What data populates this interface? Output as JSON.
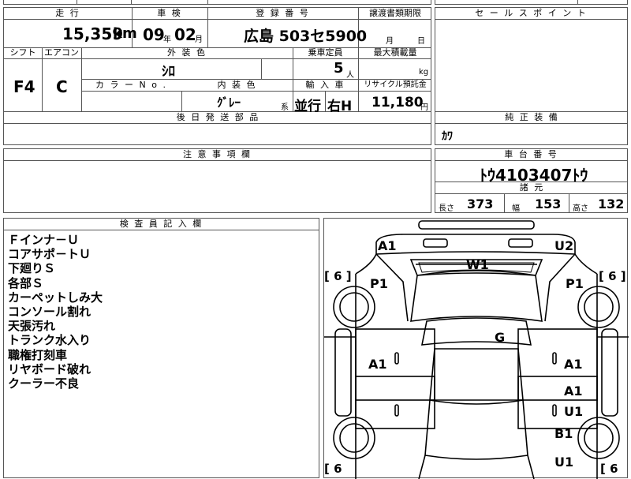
{
  "top_fragment": "",
  "mileage": {
    "header": "走 行",
    "value": "15,359",
    "unit": "km"
  },
  "inspection": {
    "header": "車 検",
    "year": "09",
    "year_unit": "年",
    "month": "02",
    "month_unit": "月"
  },
  "registration": {
    "header": "登 録 番 号",
    "value": "広島 503セ5900"
  },
  "transfer_docs": {
    "header": "譲渡書類期限",
    "month_unit": "月",
    "day_unit": "日"
  },
  "shift": {
    "header": "シフト",
    "value": "F4"
  },
  "aircon": {
    "header": "エアコン",
    "value": "C"
  },
  "exterior_color": {
    "header": "外 装 色",
    "value": "ｼﾛ"
  },
  "color_no": {
    "header": "カ ラ ー N o ."
  },
  "interior_color": {
    "header": "内 装 色",
    "value": "ｸﾞﾚｰ",
    "suffix": "系"
  },
  "capacity": {
    "header": "乗車定員",
    "value": "5",
    "unit": "人"
  },
  "max_load": {
    "header": "最大積載量",
    "unit": "kg"
  },
  "import": {
    "header": "輸 入 車",
    "value1": "並行",
    "value2": "右H"
  },
  "recycle": {
    "header": "リサイクル預託金",
    "value": "11,180",
    "unit": "円"
  },
  "later_parts": {
    "header": "後 日 発 送 部 品"
  },
  "sales_point": {
    "header": "セ ー ル ス ポ イ ン ト"
  },
  "genuine_equipment": {
    "header": "純 正 装 備",
    "value": "ｶﾜ"
  },
  "caution": {
    "header": "注 意 事 項 欄"
  },
  "chassis": {
    "header": "車 台 番 号",
    "value": "ﾄｳ4103407ﾄｳ"
  },
  "specs": {
    "header": "諸 元",
    "length_label": "長さ",
    "length": "373",
    "width_label": "幅",
    "width": "153",
    "height_label": "高さ",
    "height": "132"
  },
  "inspector": {
    "header": "検 査 員 記 入 欄",
    "notes": [
      "Ｆインナ－Ｕ",
      "コアサポ－トＵ",
      "下廻りＳ",
      "各部Ｓ",
      "カーペットしみ大",
      "コンソール割れ",
      "天張汚れ",
      "トランク水入り",
      "職権打刻車",
      "リヤボード破れ",
      "クーラー不良"
    ]
  },
  "diagram": {
    "labels": {
      "front_left": "A1",
      "front_right": "U2",
      "windshield": "W1",
      "left_front_fender": "P1",
      "right_front_fender": "P1",
      "tire_left": "[ 6 ]",
      "tire_right": "[ 6 ]",
      "roof": "G",
      "left_door": "A1",
      "right_front_door": "A1",
      "right_rear_door_a": "A1",
      "right_rear_door_u": "U1",
      "right_quarter": "B1",
      "right_rear": "U1",
      "tire_bottom_left": "[ 6",
      "tire_bottom_right": "[ 6"
    }
  }
}
